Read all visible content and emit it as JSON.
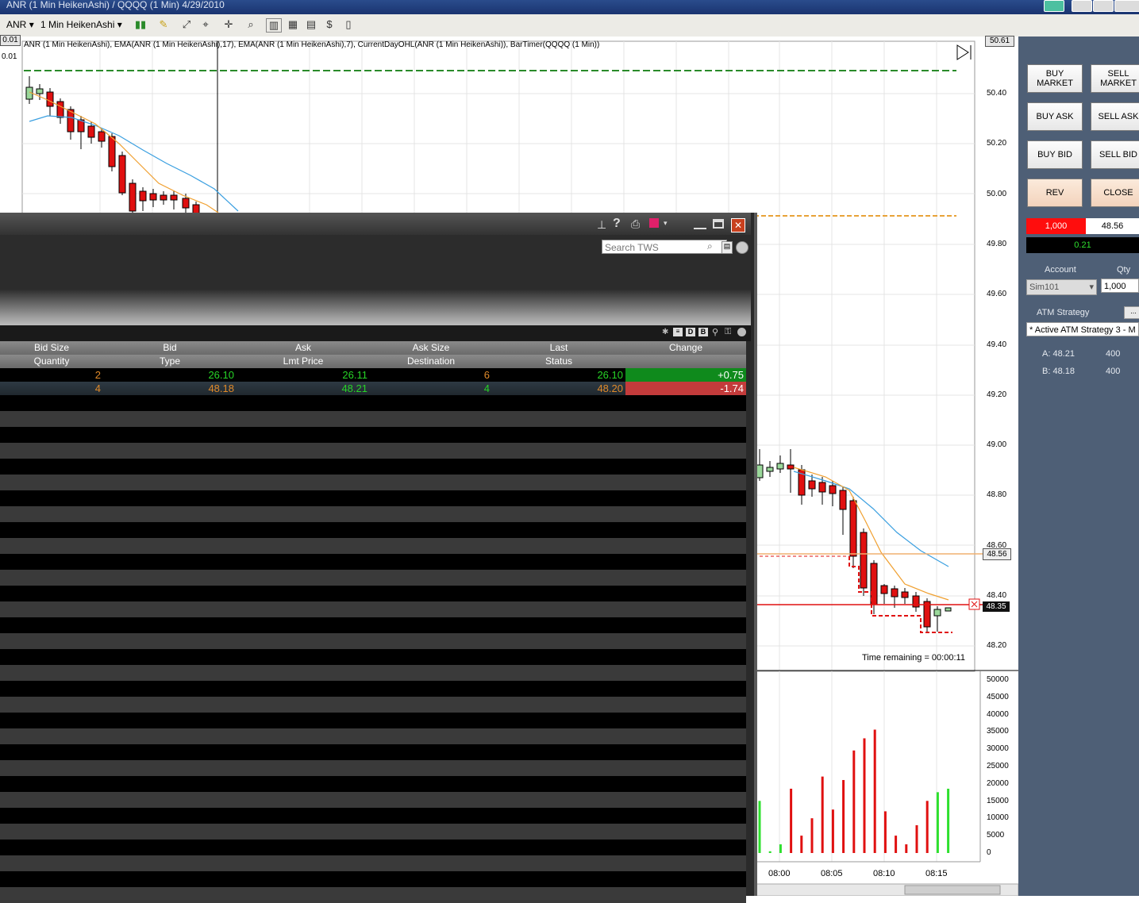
{
  "window": {
    "title": "ANR (1 Min HeikenAshi) / QQQQ (1 Min)  4/29/2010"
  },
  "toolbar": {
    "instrument": "ANR",
    "period": "1 Min HeikenAshi"
  },
  "chart": {
    "indicator_label": "ANR (1 Min HeikenAshi), EMA(ANR (1 Min HeikenAshi),17), EMA(ANR (1 Min HeikenAshi),7), CurrentDayOHL(ANR (1 Min HeikenAshi)), BarTimer(QQQQ (1 Min))",
    "left_value": "0.01",
    "top_label": "50.61",
    "price_ticks": [
      "50.40",
      "50.20",
      "50.00",
      "49.80",
      "49.60",
      "49.40",
      "49.20",
      "49.00",
      "48.80",
      "48.60",
      "48.40",
      "48.20"
    ],
    "price_marker_orange": "48.56",
    "price_marker_red": "48.35",
    "time_remaining": "Time remaining = 00:00:11",
    "volume_ticks": [
      "50000",
      "45000",
      "40000",
      "35000",
      "30000",
      "25000",
      "20000",
      "15000",
      "10000",
      "5000",
      "0"
    ],
    "time_ticks": [
      "08:00",
      "08:05",
      "08:10",
      "08:15"
    ]
  },
  "chart_data": {
    "type": "bar",
    "title": "",
    "xlabel": "",
    "ylabel": "",
    "x": [
      "07:58",
      "07:59",
      "08:00",
      "08:01",
      "08:02",
      "08:03",
      "08:04",
      "08:05",
      "08:06",
      "08:07",
      "08:08",
      "08:09",
      "08:10",
      "08:11",
      "08:12",
      "08:13",
      "08:14",
      "08:15",
      "08:16"
    ],
    "series": [
      {
        "values": [
          15000,
          500,
          2500,
          18500,
          5000,
          10000,
          22000,
          12500,
          21000,
          29500,
          33000,
          35500,
          12000,
          5000,
          2500,
          8000,
          15000,
          17500,
          18500
        ]
      }
    ],
    "ylim": [
      0,
      50000
    ]
  },
  "panel": {
    "buy_market": "BUY MARKET",
    "sell_market": "SELL MARKET",
    "buy_ask": "BUY ASK",
    "sell_ask": "SELL ASK",
    "buy_bid": "BUY BID",
    "sell_bid": "SELL BID",
    "rev": "REV",
    "close": "CLOSE",
    "position_qty": "1,000",
    "position_price": "48.56",
    "pnl": "0.21",
    "account_label": "Account",
    "qty_label": "Qty",
    "account": "Sim101",
    "qty": "1,000",
    "atm_label": "ATM Strategy",
    "atm_value": "* Active ATM Strategy 3 - M",
    "ask_line": "A: 48.21",
    "ask_size": "400",
    "bid_line": "B: 48.18",
    "bid_size": "400"
  },
  "tws": {
    "search_placeholder": "Search TWS",
    "headers1": [
      "Bid Size",
      "Bid",
      "Ask",
      "Ask Size",
      "Last",
      "Change"
    ],
    "headers2": [
      "Quantity",
      "Type",
      "Lmt Price",
      "Destination",
      "Status",
      ""
    ],
    "rows": [
      {
        "bid_size": "2",
        "bid": "26.10",
        "ask": "26.11",
        "ask_size": "6",
        "last": "26.10",
        "change": "+0.75"
      },
      {
        "bid_size": "4",
        "bid": "48.18",
        "ask": "48.21",
        "ask_size": "4",
        "last": "48.20",
        "change": "-1.74"
      }
    ],
    "colors": {
      "up": "#0f8a1c",
      "down": "#c33b3b",
      "green_text": "#27d427",
      "orange_text": "#e08a2a"
    }
  }
}
